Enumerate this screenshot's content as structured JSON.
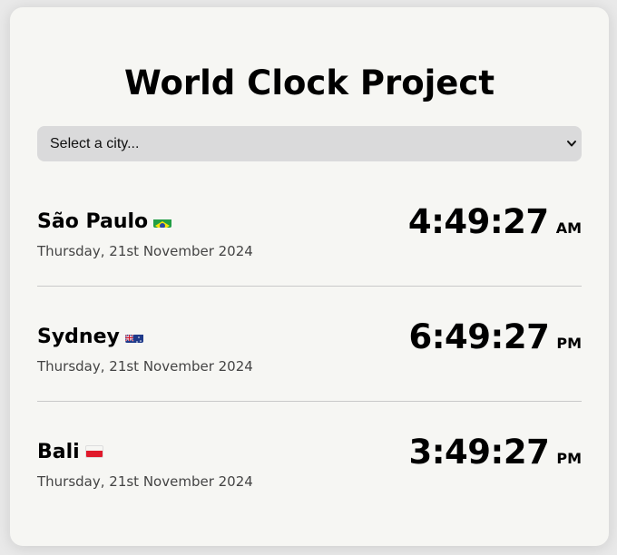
{
  "title": "World Clock Project",
  "city_select": {
    "selected": "Select a city..."
  },
  "cities": [
    {
      "name": "São Paulo",
      "flag_icon": "brazil-flag-icon",
      "date": "Thursday, 21st November 2024",
      "time": "4:49:27",
      "period": "AM"
    },
    {
      "name": "Sydney",
      "flag_icon": "australia-flag-icon",
      "date": "Thursday, 21st November 2024",
      "time": "6:49:27",
      "period": "PM"
    },
    {
      "name": "Bali",
      "flag_icon": "indonesia-flag-icon",
      "date": "Thursday, 21st November 2024",
      "time": "3:49:27",
      "period": "PM"
    }
  ],
  "colors": {
    "background": "#e9e9e9",
    "card": "#f6f6f3",
    "select": "#dadadb",
    "text": "#000000",
    "secondary_text": "#444444"
  }
}
